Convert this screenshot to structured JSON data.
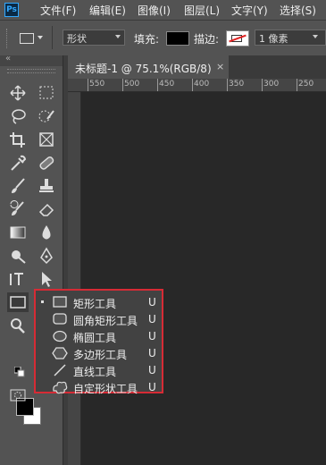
{
  "app": {
    "logo": "Ps"
  },
  "menu": [
    "文件(F)",
    "编辑(E)",
    "图像(I)",
    "图层(L)",
    "文字(Y)",
    "选择(S)"
  ],
  "options": {
    "shape_mode": "形状",
    "fill_label": "填充:",
    "stroke_label": "描边:",
    "stroke_width": "1 像素",
    "fill_color": "#000000",
    "stroke_color": "#ffffff"
  },
  "document": {
    "tab_title": "未标题-1 @ 75.1%(RGB/8)",
    "close": "×",
    "ruler_h": [
      "550",
      "500",
      "450",
      "400",
      "350",
      "300",
      "250"
    ]
  },
  "toolbox": {
    "collapse": "«",
    "foreground": "#000000",
    "background": "#ffffff"
  },
  "flyout": {
    "items": [
      {
        "label": "矩形工具",
        "key": "U",
        "icon": "rectangle-icon",
        "selected": true
      },
      {
        "label": "圆角矩形工具",
        "key": "U",
        "icon": "rounded-rectangle-icon",
        "selected": false
      },
      {
        "label": "椭圆工具",
        "key": "U",
        "icon": "ellipse-icon",
        "selected": false
      },
      {
        "label": "多边形工具",
        "key": "U",
        "icon": "polygon-icon",
        "selected": false
      },
      {
        "label": "直线工具",
        "key": "U",
        "icon": "line-icon",
        "selected": false
      },
      {
        "label": "自定形状工具",
        "key": "U",
        "icon": "custom-shape-icon",
        "selected": false
      }
    ],
    "highlight_color": "#d62b35"
  }
}
